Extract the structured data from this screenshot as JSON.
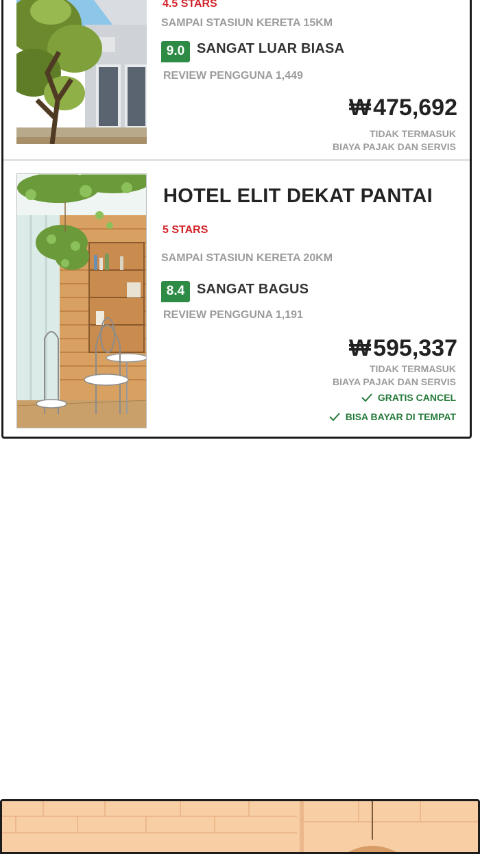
{
  "listings": [
    {
      "stars": "4.5 STARS",
      "distance": "SAMPAI STASIUN KERETA 15KM",
      "score": "9.0",
      "score_label": "SANGAT LUAR BIASA",
      "reviews": "REVIEW PENGGUNA 1,449",
      "currency": "₩",
      "price": "475,692",
      "tax_line1": "TIDAK TERMASUK",
      "tax_line2": "BIAYA PAJAK DAN SERVIS"
    },
    {
      "title": "HOTEL ELIT DEKAT PANTAI",
      "stars": "5 STARS",
      "distance": "SAMPAI STASIUN KERETA 20KM",
      "score": "8.4",
      "score_label": "SANGAT BAGUS",
      "reviews": "REVIEW PENGGUNA 1,191",
      "currency": "₩",
      "price": "595,337",
      "tax_line1": "TIDAK TERMASUK",
      "tax_line2": "BIAYA PAJAK DAN SERVIS",
      "perks": [
        "GRATIS CANCEL",
        "BISA BAYAR DI TEMPAT"
      ]
    }
  ],
  "icons": {
    "check": "check-icon"
  },
  "colors": {
    "stars": "#d1232a",
    "score_badge": "#2e8b45",
    "perk": "#257a3a",
    "muted_text": "#9c9c9c",
    "border": "#1c1c1c"
  }
}
